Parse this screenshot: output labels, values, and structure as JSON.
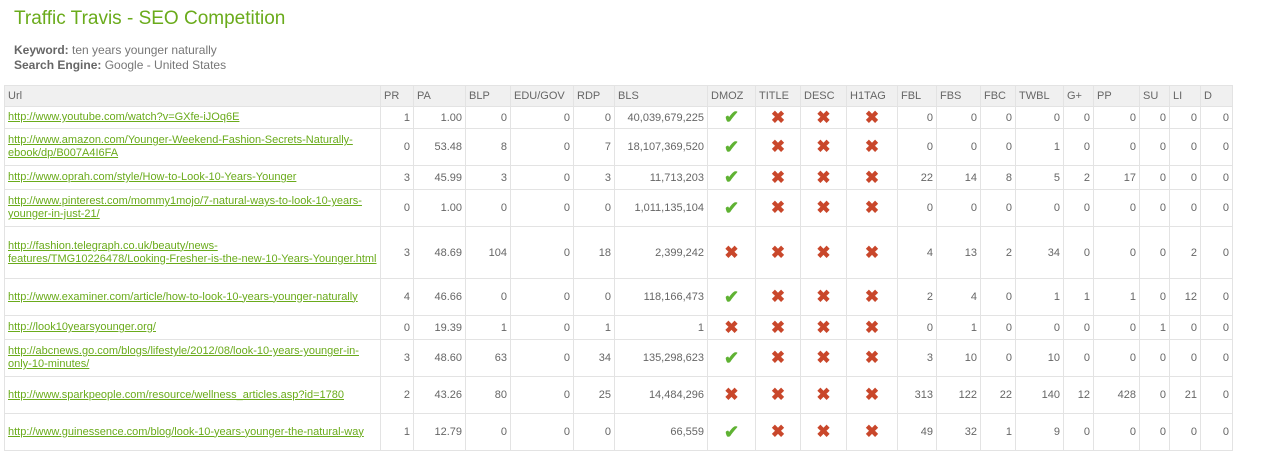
{
  "title": "Traffic Travis - SEO Competition",
  "meta": {
    "keyword_label": "Keyword:",
    "keyword_value": " ten years younger naturally",
    "engine_label": "Search Engine:",
    "engine_value": " Google - United States"
  },
  "colors": {
    "accent": "#6aab1b",
    "check": "#5fb233",
    "cross": "#c9472b"
  },
  "columns": [
    "Url",
    "PR",
    "PA",
    "BLP",
    "EDU/GOV",
    "RDP",
    "BLS",
    "DMOZ",
    "TITLE",
    "DESC",
    "H1TAG",
    "FBL",
    "FBS",
    "FBC",
    "TWBL",
    "G+",
    "PP",
    "SU",
    "LI",
    "D"
  ],
  "rows": [
    {
      "url": "http://www.youtube.com/watch?v=GXfe-iJOq6E",
      "pr": "1",
      "pa": "1.00",
      "blp": "0",
      "edu": "0",
      "rdp": "0",
      "bls": "40,039,679,225",
      "dmoz": true,
      "title": false,
      "desc": false,
      "h1": false,
      "fbl": "0",
      "fbs": "0",
      "fbc": "0",
      "twbl": "0",
      "gp": "0",
      "pp": "0",
      "su": "0",
      "li": "0",
      "d": "0"
    },
    {
      "url": "http://www.amazon.com/Younger-Weekend-Fashion-Secrets-Naturally-ebook/dp/B007A4I6FA",
      "pr": "0",
      "pa": "53.48",
      "blp": "8",
      "edu": "0",
      "rdp": "7",
      "bls": "18,107,369,520",
      "dmoz": true,
      "title": false,
      "desc": false,
      "h1": false,
      "fbl": "0",
      "fbs": "0",
      "fbc": "0",
      "twbl": "1",
      "gp": "0",
      "pp": "0",
      "su": "0",
      "li": "0",
      "d": "0"
    },
    {
      "url": "http://www.oprah.com/style/How-to-Look-10-Years-Younger",
      "pr": "3",
      "pa": "45.99",
      "blp": "3",
      "edu": "0",
      "rdp": "3",
      "bls": "11,713,203",
      "dmoz": true,
      "title": false,
      "desc": false,
      "h1": false,
      "fbl": "22",
      "fbs": "14",
      "fbc": "8",
      "twbl": "5",
      "gp": "2",
      "pp": "17",
      "su": "0",
      "li": "0",
      "d": "0"
    },
    {
      "url": "http://www.pinterest.com/mommy1mojo/7-natural-ways-to-look-10-years-younger-in-just-21/",
      "pr": "0",
      "pa": "1.00",
      "blp": "0",
      "edu": "0",
      "rdp": "0",
      "bls": "1,011,135,104",
      "dmoz": true,
      "title": false,
      "desc": false,
      "h1": false,
      "fbl": "0",
      "fbs": "0",
      "fbc": "0",
      "twbl": "0",
      "gp": "0",
      "pp": "0",
      "su": "0",
      "li": "0",
      "d": "0"
    },
    {
      "url": "http://fashion.telegraph.co.uk/beauty/news-features/TMG10226478/Looking-Fresher-is-the-new-10-Years-Younger.html",
      "pr": "3",
      "pa": "48.69",
      "blp": "104",
      "edu": "0",
      "rdp": "18",
      "bls": "2,399,242",
      "dmoz": false,
      "title": false,
      "desc": false,
      "h1": false,
      "fbl": "4",
      "fbs": "13",
      "fbc": "2",
      "twbl": "34",
      "gp": "0",
      "pp": "0",
      "su": "0",
      "li": "2",
      "d": "0"
    },
    {
      "url": "http://www.examiner.com/article/how-to-look-10-years-younger-naturally",
      "pr": "4",
      "pa": "46.66",
      "blp": "0",
      "edu": "0",
      "rdp": "0",
      "bls": "118,166,473",
      "dmoz": true,
      "title": false,
      "desc": false,
      "h1": false,
      "fbl": "2",
      "fbs": "4",
      "fbc": "0",
      "twbl": "1",
      "gp": "1",
      "pp": "1",
      "su": "0",
      "li": "12",
      "d": "0"
    },
    {
      "url": "http://look10yearsyounger.org/",
      "pr": "0",
      "pa": "19.39",
      "blp": "1",
      "edu": "0",
      "rdp": "1",
      "bls": "1",
      "dmoz": false,
      "title": false,
      "desc": false,
      "h1": false,
      "fbl": "0",
      "fbs": "1",
      "fbc": "0",
      "twbl": "0",
      "gp": "0",
      "pp": "0",
      "su": "1",
      "li": "0",
      "d": "0"
    },
    {
      "url": "http://abcnews.go.com/blogs/lifestyle/2012/08/look-10-years-younger-in-only-10-minutes/",
      "pr": "3",
      "pa": "48.60",
      "blp": "63",
      "edu": "0",
      "rdp": "34",
      "bls": "135,298,623",
      "dmoz": true,
      "title": false,
      "desc": false,
      "h1": false,
      "fbl": "3",
      "fbs": "10",
      "fbc": "0",
      "twbl": "10",
      "gp": "0",
      "pp": "0",
      "su": "0",
      "li": "0",
      "d": "0"
    },
    {
      "url": "http://www.sparkpeople.com/resource/wellness_articles.asp?id=1780",
      "pr": "2",
      "pa": "43.26",
      "blp": "80",
      "edu": "0",
      "rdp": "25",
      "bls": "14,484,296",
      "dmoz": false,
      "title": false,
      "desc": false,
      "h1": false,
      "fbl": "313",
      "fbs": "122",
      "fbc": "22",
      "twbl": "140",
      "gp": "12",
      "pp": "428",
      "su": "0",
      "li": "21",
      "d": "0"
    },
    {
      "url": "http://www.guinessence.com/blog/look-10-years-younger-the-natural-way",
      "pr": "1",
      "pa": "12.79",
      "blp": "0",
      "edu": "0",
      "rdp": "0",
      "bls": "66,559",
      "dmoz": true,
      "title": false,
      "desc": false,
      "h1": false,
      "fbl": "49",
      "fbs": "32",
      "fbc": "1",
      "twbl": "9",
      "gp": "0",
      "pp": "0",
      "su": "0",
      "li": "0",
      "d": "0"
    }
  ]
}
